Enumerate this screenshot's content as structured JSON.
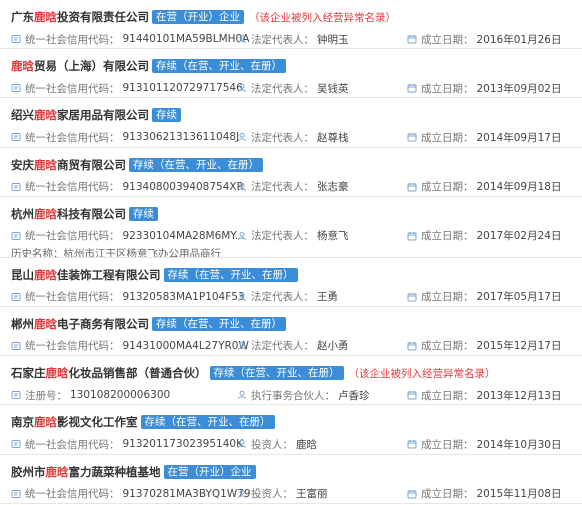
{
  "labels": {
    "credit_code": "统一社会信用代码：",
    "legal_rep": "法定代表人：",
    "established": "成立日期：",
    "history_name": "历史名称：",
    "reg_no": "注册号：",
    "partner": "执行事务合伙人：",
    "investor": "投资人："
  },
  "keyword": "鹿晗",
  "companies": [
    {
      "name_pre": "广东",
      "name_kw": "鹿晗",
      "name_post": "投资有限责任公司",
      "status": "在营（开业）企业",
      "warning": "（该企业被列入经营异常名录）",
      "code": "91440101MA59BLMH0A",
      "rep": "钟明玉",
      "date": "2016年01月26日"
    },
    {
      "name_pre": "",
      "name_kw": "鹿晗",
      "name_post": "贸易（上海）有限公司",
      "status": "存续（在营、开业、在册）",
      "code": "913101120729717546",
      "rep": "吴钱英",
      "date": "2013年09月02日"
    },
    {
      "name_pre": "绍兴",
      "name_kw": "鹿晗",
      "name_post": "家居用品有限公司",
      "status": "存续",
      "code": "91330621313611048J",
      "rep": "赵尊栈",
      "date": "2014年09月17日"
    },
    {
      "name_pre": "安庆",
      "name_kw": "鹿晗",
      "name_post": "商贸有限公司",
      "status": "存续（在营、开业、在册）",
      "code": "9134080039408754XR",
      "rep": "张志豪",
      "date": "2014年09月18日"
    },
    {
      "name_pre": "杭州",
      "name_kw": "鹿晗",
      "name_post": "科技有限公司",
      "status": "存续",
      "code": "92330104MA28M6MY...",
      "rep": "杨意飞",
      "date": "2017年02月24日",
      "history": "杭州市江干区杨意飞办公用品商行"
    },
    {
      "name_pre": "昆山",
      "name_kw": "鹿晗",
      "name_post": "佳装饰工程有限公司",
      "status": "存续（在营、开业、在册）",
      "code": "91320583MA1P104F53",
      "rep": "王勇",
      "date": "2017年05月17日"
    },
    {
      "name_pre": "郴州",
      "name_kw": "鹿晗",
      "name_post": "电子商务有限公司",
      "status": "存续（在营、开业、在册）",
      "code": "91431000MA4L27YR0W",
      "rep": "赵小勇",
      "date": "2015年12月17日"
    },
    {
      "name_pre": "石家庄",
      "name_kw": "鹿晗",
      "name_post": "化妆品销售部（普通合伙）",
      "status": "存续（在营、开业、在册）",
      "warning": "（该企业被列入经营异常名录）",
      "reg_no": "130108200006300",
      "partner": "卢香珍",
      "date": "2013年12月13日"
    },
    {
      "name_pre": "南京",
      "name_kw": "鹿晗",
      "name_post": "影视文化工作室",
      "status": "存续（在营、开业、在册）",
      "code": "91320117302395140K",
      "investor": "鹿晗",
      "date": "2014年10月30日"
    },
    {
      "name_pre": "胶州市",
      "name_kw": "鹿晗",
      "name_post": "富力蔬菜种植基地",
      "status": "在营（开业）企业",
      "code": "91370281MA3BYQ1W79",
      "investor": "王富丽",
      "date": "2015年11月08日"
    }
  ]
}
